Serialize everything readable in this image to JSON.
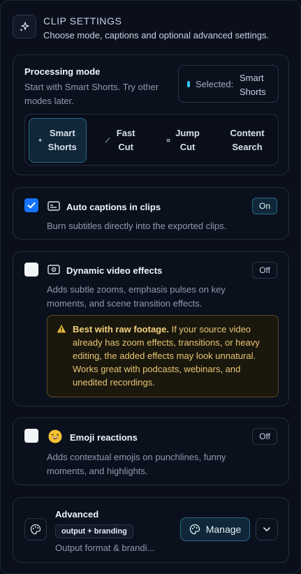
{
  "header": {
    "title": "CLIP SETTINGS",
    "subtitle": "Choose mode, captions and optional advanced settings."
  },
  "processing": {
    "title": "Processing mode",
    "description": "Start with Smart Shorts. Try other modes later.",
    "selected_label": "Selected:",
    "selected_value": "Smart Shorts",
    "modes": [
      {
        "label": "Smart Shorts",
        "icon": "sparkle-icon",
        "active": true
      },
      {
        "label": "Fast Cut",
        "icon": "wand-icon",
        "active": false
      },
      {
        "label": "Jump Cut",
        "icon": "crop-icon",
        "active": false
      },
      {
        "label": "Content Search",
        "icon": "",
        "active": false
      }
    ]
  },
  "captions": {
    "title": "Auto captions in clips",
    "description": "Burn subtitles directly into the exported clips.",
    "checked": true,
    "state_label": "On"
  },
  "effects": {
    "title": "Dynamic video effects",
    "description": "Adds subtle zooms, emphasis pulses on key moments, and scene transition effects.",
    "checked": false,
    "state_label": "Off",
    "warning_bold": "Best with raw footage.",
    "warning_text": " If your source video already has zoom effects, transitions, or heavy editing, the added effects may look unnatural. Works great with podcasts, webinars, and unedited recordings."
  },
  "emoji": {
    "title": "Emoji reactions",
    "description": "Adds contextual emojis on punchlines, funny moments, and highlights.",
    "checked": false,
    "state_label": "Off"
  },
  "advanced": {
    "title": "Advanced",
    "badge": "output + branding",
    "subtitle": "Output format & brandi...",
    "manage_label": "Manage"
  },
  "colors": {
    "accent": "#2ec8f0",
    "checkbox_on": "#1673ff",
    "warning_text": "#e8c775"
  }
}
